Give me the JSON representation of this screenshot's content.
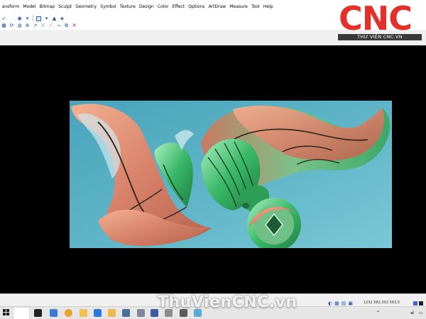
{
  "menubar": {
    "items": [
      "ansform",
      "Model",
      "Bitmap",
      "Sculpt",
      "Geometry",
      "Symbol",
      "Texture",
      "Design",
      "Color",
      "Effect",
      "Options",
      "ArtDraw",
      "Measure",
      "Tool",
      "Help"
    ]
  },
  "logo": {
    "main": "CNC",
    "sub": "THƯ VIỆN CNC.VN"
  },
  "statusbar": {
    "coords": "1232.582,302.583,0"
  },
  "taskbar": {
    "search_placeholder": "",
    "clock": "10:32 AM"
  },
  "watermark": {
    "text": "ThuVienCNC.vn"
  },
  "colors": {
    "relief_bg": "#5fb6c8",
    "relief_copper": "#d8866a",
    "relief_green": "#3fb86a",
    "logo_red": "#e2312a",
    "viewport": "#000000"
  }
}
